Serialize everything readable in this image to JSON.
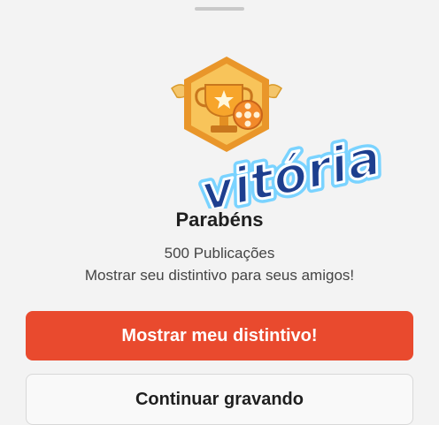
{
  "sheet": {
    "title": "Parabéns",
    "badge_icon": "trophy-badge-icon",
    "sticker_text": "vitória",
    "subtitle": "500 Publicações",
    "message": "Mostrar seu distintivo para seus amigos!",
    "primary_button": "Mostrar meu distintivo!",
    "secondary_button": "Continuar gravando"
  },
  "colors": {
    "primary": "#e94a2e",
    "badge_gold": "#f2b233",
    "sticker_fill": "#1e3f8f",
    "sticker_shadow": "#7ad3ff"
  }
}
